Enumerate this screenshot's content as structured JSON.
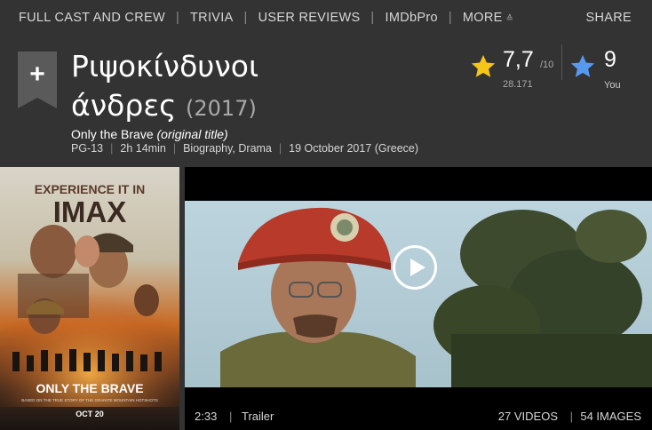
{
  "nav": {
    "items": [
      "FULL CAST AND CREW",
      "TRIVIA",
      "USER REVIEWS",
      "IMDbPro",
      "MORE"
    ],
    "more_icon": "chevron-double-down-icon",
    "share": "SHARE"
  },
  "watchlist": {
    "icon": "plus-icon",
    "label": "+"
  },
  "title": {
    "line1": "Ριψοκίνδυνοι",
    "line2": "άνδρες",
    "year": "(2017)",
    "original": "Only the Brave",
    "original_note": "(original title)"
  },
  "meta": {
    "rating": "PG-13",
    "runtime": "2h 14min",
    "genres": "Biography, Drama",
    "release": "19 October 2017 (Greece)"
  },
  "imdb_rating": {
    "icon": "star-icon",
    "score": "7,7",
    "out_of": "/10",
    "count": "28.171",
    "star_color": "#f5c518"
  },
  "user_rating": {
    "icon": "star-icon",
    "value": "9",
    "label": "You",
    "star_color": "#5799ef"
  },
  "poster": {
    "top_text_1": "EXPERIENCE IT IN",
    "top_text_2": "IMAX",
    "title": "ONLY THE BRAVE",
    "tagline": "BASED ON THE TRUE STORY OF THE GRANITE MOUNTAIN HOTSHOTS",
    "date": "OCT 20"
  },
  "video": {
    "play_icon": "play-icon",
    "duration": "2:33",
    "type": "Trailer",
    "videos_count": "27 VIDEOS",
    "images_count": "54 IMAGES"
  }
}
